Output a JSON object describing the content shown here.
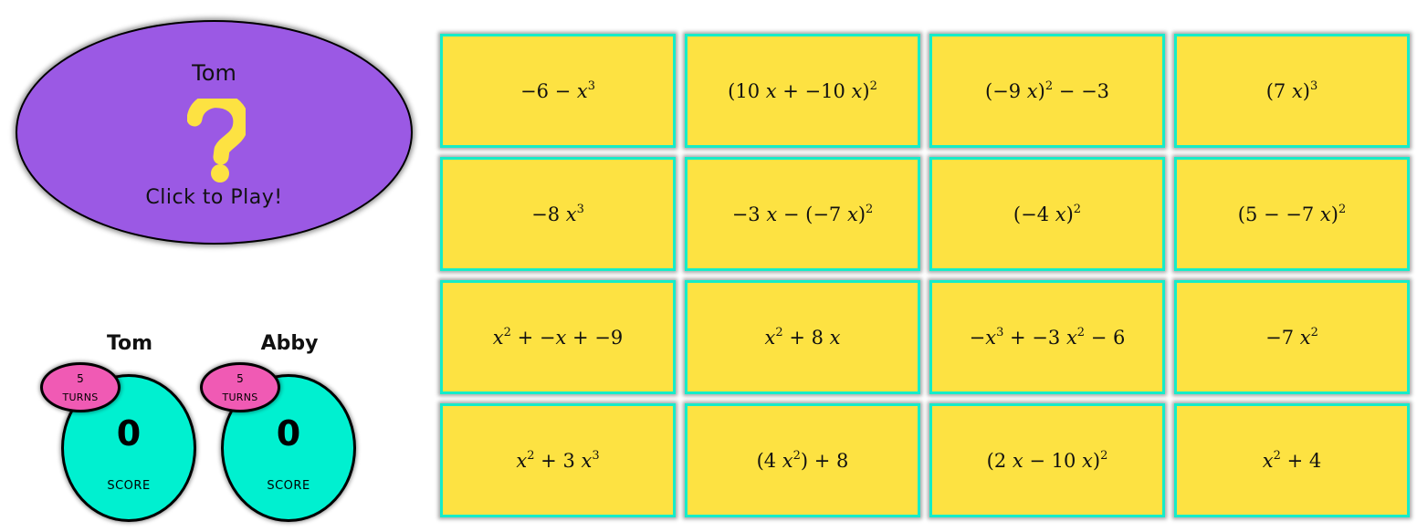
{
  "turn_panel": {
    "current_player": "Tom",
    "icon": "question-mark-icon",
    "call_to_action": "Click to Play!",
    "colors": {
      "background": "#9b59e4",
      "icon": "#fde242"
    }
  },
  "players": [
    {
      "name": "Tom",
      "turns_value": "5",
      "turns_label": "TURNS",
      "score_value": "0",
      "score_label": "SCORE"
    },
    {
      "name": "Abby",
      "turns_value": "5",
      "turns_label": "TURNS",
      "score_value": "0",
      "score_label": "SCORE"
    }
  ],
  "colors": {
    "score_bubble": "#00f0d0",
    "turns_bubble": "#f05ab4",
    "card_face": "#fde242",
    "card_border": "#16ecc8"
  },
  "cards": [
    {
      "expression": "−6 − x^3",
      "html": "−6 − <i>x</i><sup>3</sup>"
    },
    {
      "expression": "(10 x + −10 x)^2",
      "html": "(10 <i>x</i> + −10 <i>x</i>)<sup>2</sup>"
    },
    {
      "expression": "(−9 x)^2 − −3",
      "html": "(−9 <i>x</i>)<sup>2</sup> − −3"
    },
    {
      "expression": "(7 x)^3",
      "html": "(7 <i>x</i>)<sup>3</sup>"
    },
    {
      "expression": "−8 x^3",
      "html": "−8 <i>x</i><sup>3</sup>"
    },
    {
      "expression": "−3 x − (−7 x)^2",
      "html": "−3 <i>x</i> − (−7 <i>x</i>)<sup>2</sup>"
    },
    {
      "expression": "(−4 x)^2",
      "html": "(−4 <i>x</i>)<sup>2</sup>"
    },
    {
      "expression": "(5 − −7 x)^2",
      "html": "(5 − −7 <i>x</i>)<sup>2</sup>"
    },
    {
      "expression": "x^2 + −x + −9",
      "html": "<i>x</i><sup>2</sup> + −<i>x</i> + −9"
    },
    {
      "expression": "x^2 + 8 x",
      "html": "<i>x</i><sup>2</sup> + 8 <i>x</i>"
    },
    {
      "expression": "−x^3 + −3 x^2 − 6",
      "html": "−<i>x</i><sup>3</sup> + −3 <i>x</i><sup>2</sup> − 6"
    },
    {
      "expression": "−7 x^2",
      "html": "−7 <i>x</i><sup>2</sup>"
    },
    {
      "expression": "x^2 + 3 x^3",
      "html": "<i>x</i><sup>2</sup> + 3 <i>x</i><sup>3</sup>"
    },
    {
      "expression": "(4 x^2) + 8",
      "html": "(4 <i>x</i><sup>2</sup>) + 8"
    },
    {
      "expression": "(2 x − 10 x)^2",
      "html": "(2 <i>x</i> − 10 <i>x</i>)<sup>2</sup>"
    },
    {
      "expression": "x^2 + 4",
      "html": "<i>x</i><sup>2</sup> + 4"
    }
  ]
}
